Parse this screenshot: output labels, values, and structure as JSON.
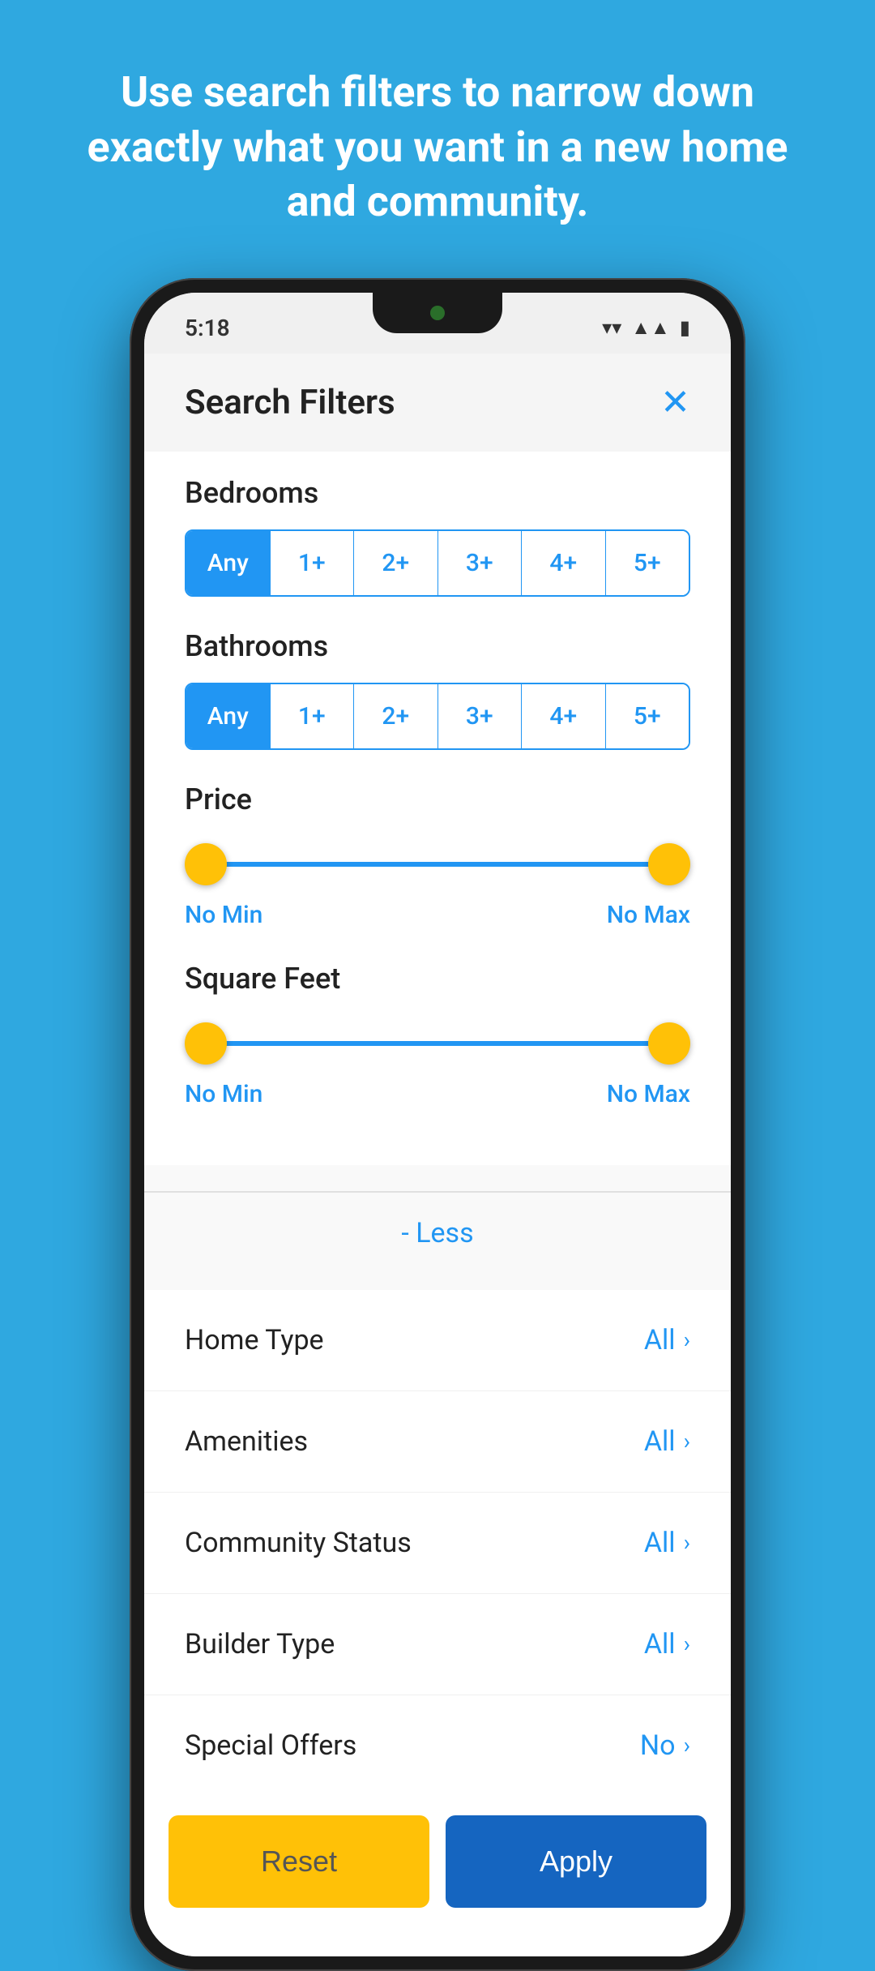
{
  "hero": {
    "text": "Use search filters to narrow down exactly what you want in a new home and community."
  },
  "status_bar": {
    "time": "5:18"
  },
  "header": {
    "title": "Search Filters",
    "close_label": "✕"
  },
  "bedrooms": {
    "label": "Bedrooms",
    "options": [
      "Any",
      "1+",
      "2+",
      "3+",
      "4+",
      "5+"
    ],
    "selected_index": 0
  },
  "bathrooms": {
    "label": "Bathrooms",
    "options": [
      "Any",
      "1+",
      "2+",
      "3+",
      "4+",
      "5+"
    ],
    "selected_index": 0
  },
  "price": {
    "label": "Price",
    "min_label": "No Min",
    "max_label": "No Max"
  },
  "square_feet": {
    "label": "Square Feet",
    "min_label": "No Min",
    "max_label": "No Max"
  },
  "less_button": {
    "label": "- Less"
  },
  "filter_items": [
    {
      "label": "Home Type",
      "value": "All"
    },
    {
      "label": "Amenities",
      "value": "All"
    },
    {
      "label": "Community Status",
      "value": "All"
    },
    {
      "label": "Builder Type",
      "value": "All"
    },
    {
      "label": "Special Offers",
      "value": "No"
    }
  ],
  "actions": {
    "reset_label": "Reset",
    "apply_label": "Apply"
  }
}
